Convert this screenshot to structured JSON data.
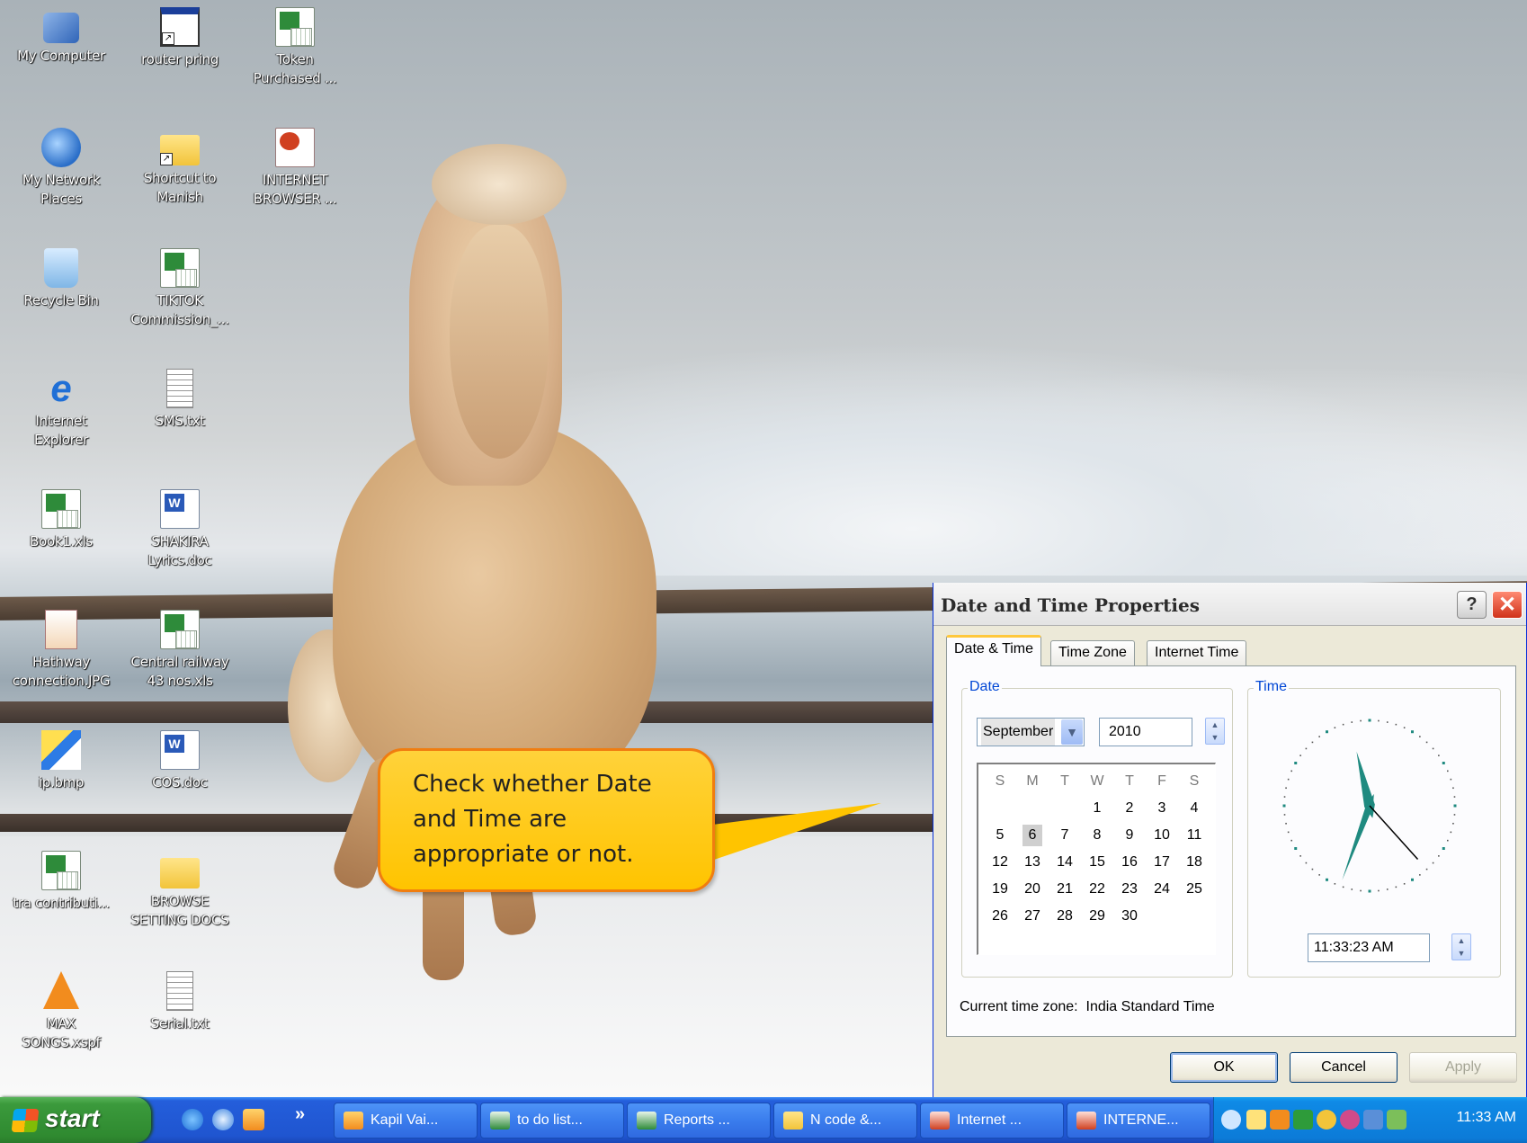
{
  "desktop": {
    "icons": [
      {
        "label": "My Computer",
        "icon": "my-computer-icon"
      },
      {
        "label": "router pring",
        "icon": "window-shortcut-icon"
      },
      {
        "label": "Token Purchased ...",
        "icon": "excel-file-icon"
      },
      {
        "label": "My Network Places",
        "icon": "network-places-icon"
      },
      {
        "label": "Shortcut to Manish",
        "icon": "folder-shortcut-icon"
      },
      {
        "label": "INTERNET BROWSER ...",
        "icon": "powerpoint-file-icon"
      },
      {
        "label": "Recycle Bin",
        "icon": "recycle-bin-icon"
      },
      {
        "label": "TIKTOK Commission_...",
        "icon": "excel-file-icon"
      },
      {
        "label": "Internet Explorer",
        "icon": "internet-explorer-icon"
      },
      {
        "label": "SMS.txt",
        "icon": "text-file-icon"
      },
      {
        "label": "Book1.xls",
        "icon": "excel-file-icon"
      },
      {
        "label": "SHAKIRA Lyrics.doc",
        "icon": "word-file-icon"
      },
      {
        "label": "Hathway connection.JPG",
        "icon": "jpg-file-icon"
      },
      {
        "label": "Central railway 43 nos.xls",
        "icon": "excel-file-icon"
      },
      {
        "label": "ip.bmp",
        "icon": "bitmap-file-icon"
      },
      {
        "label": "COS.doc",
        "icon": "word-file-icon"
      },
      {
        "label": "tra contributi...",
        "icon": "excel-file-icon"
      },
      {
        "label": "BROWSE SETTING DOCS",
        "icon": "folder-icon"
      },
      {
        "label": "MAX SONGS.xspf",
        "icon": "vlc-playlist-icon"
      },
      {
        "label": "Serial.txt",
        "icon": "text-file-icon"
      }
    ]
  },
  "callout": {
    "text": "Check whether Date and Time are appropriate or not."
  },
  "dialog": {
    "title": "Date and Time Properties",
    "help_label": "?",
    "close_label": "✕",
    "tabs": [
      "Date & Time",
      "Time Zone",
      "Internet Time"
    ],
    "date_group_label": "Date",
    "time_group_label": "Time",
    "month": "September",
    "year": "2010",
    "weekday_headers": [
      "S",
      "M",
      "T",
      "W",
      "T",
      "F",
      "S"
    ],
    "calendar_days": [
      "",
      "",
      "",
      "1",
      "2",
      "3",
      "4",
      "5",
      "6",
      "7",
      "8",
      "9",
      "10",
      "11",
      "12",
      "13",
      "14",
      "15",
      "16",
      "17",
      "18",
      "19",
      "20",
      "21",
      "22",
      "23",
      "24",
      "25",
      "26",
      "27",
      "28",
      "29",
      "30",
      "",
      ""
    ],
    "selected_day": "6",
    "time_value": "11:33:23 AM",
    "clock": {
      "hour": 11,
      "minute": 33,
      "second": 23,
      "hand_color": "#1f8a80"
    },
    "timezone_label": "Current time zone:",
    "timezone_value": "India Standard Time",
    "buttons": {
      "ok": "OK",
      "cancel": "Cancel",
      "apply": "Apply"
    }
  },
  "taskbar": {
    "start_label": "start",
    "chevron": "»",
    "tasks": [
      {
        "label": "Kapil Vai...",
        "icon": "outlook-icon"
      },
      {
        "label": "to do list...",
        "icon": "excel-icon"
      },
      {
        "label": "Reports ...",
        "icon": "excel-icon"
      },
      {
        "label": "N code &...",
        "icon": "folder-icon"
      },
      {
        "label": "Internet ...",
        "icon": "powerpoint-icon"
      },
      {
        "label": "INTERNE...",
        "icon": "powerpoint-icon"
      }
    ],
    "clock": "11:33 AM"
  },
  "colors": {
    "taskbar_blue": "#245edb",
    "start_green": "#3b9a3c",
    "callout_fill": "#ffc400",
    "callout_border": "#f07d10",
    "dialog_bg": "#ece9d8"
  }
}
